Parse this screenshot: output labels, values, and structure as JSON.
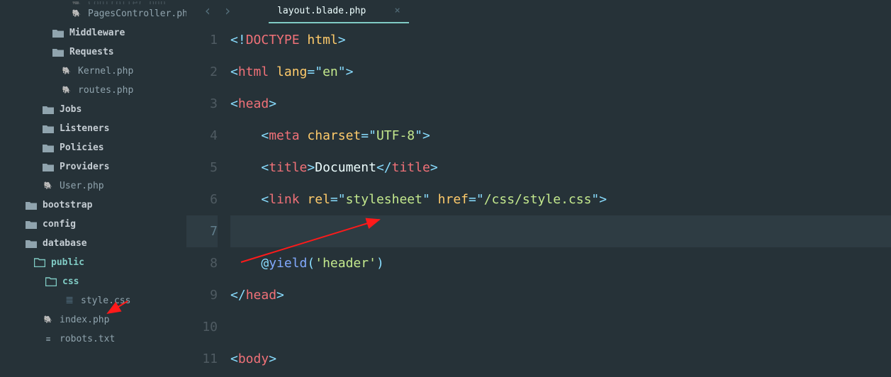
{
  "tab": {
    "title": "layout.blade.php",
    "close": "×"
  },
  "nav": {
    "back": "‹",
    "forward": "›"
  },
  "sidebar": {
    "items": [
      {
        "label": "Controller.php",
        "icon": "php",
        "indent": 100,
        "type": "file"
      },
      {
        "label": "PagesController.php",
        "icon": "php",
        "indent": 100,
        "type": "file"
      },
      {
        "label": "Middleware",
        "icon": "folder",
        "indent": 74,
        "type": "folder",
        "bold": true
      },
      {
        "label": "Requests",
        "icon": "folder",
        "indent": 74,
        "type": "folder",
        "bold": true
      },
      {
        "label": "Kernel.php",
        "icon": "php",
        "indent": 86,
        "type": "file"
      },
      {
        "label": "routes.php",
        "icon": "php",
        "indent": 86,
        "type": "file"
      },
      {
        "label": "Jobs",
        "icon": "folder",
        "indent": 60,
        "type": "folder",
        "bold": true
      },
      {
        "label": "Listeners",
        "icon": "folder",
        "indent": 60,
        "type": "folder",
        "bold": true
      },
      {
        "label": "Policies",
        "icon": "folder",
        "indent": 60,
        "type": "folder",
        "bold": true
      },
      {
        "label": "Providers",
        "icon": "folder",
        "indent": 60,
        "type": "folder",
        "bold": true
      },
      {
        "label": "User.php",
        "icon": "php",
        "indent": 60,
        "type": "file"
      },
      {
        "label": "bootstrap",
        "icon": "folder",
        "indent": 36,
        "type": "folder",
        "bold": true
      },
      {
        "label": "config",
        "icon": "folder",
        "indent": 36,
        "type": "folder",
        "bold": true
      },
      {
        "label": "database",
        "icon": "folder",
        "indent": 36,
        "type": "folder",
        "bold": true
      },
      {
        "label": "public",
        "icon": "folder-open",
        "indent": 48,
        "type": "folder",
        "bold": true,
        "active": true
      },
      {
        "label": "css",
        "icon": "folder-open",
        "indent": 64,
        "type": "folder",
        "bold": true,
        "active": true
      },
      {
        "label": "style.css",
        "icon": "css",
        "indent": 90,
        "type": "file"
      },
      {
        "label": "index.php",
        "icon": "php",
        "indent": 60,
        "type": "file"
      },
      {
        "label": "robots.txt",
        "icon": "txt",
        "indent": 60,
        "type": "file"
      }
    ]
  },
  "code": {
    "lines": [
      {
        "n": 1,
        "segs": [
          [
            "<!",
            "bracket"
          ],
          [
            "DOCTYPE ",
            "tag"
          ],
          [
            "html",
            "attr"
          ],
          [
            ">",
            "bracket"
          ]
        ]
      },
      {
        "n": 2,
        "segs": [
          [
            "<",
            "bracket"
          ],
          [
            "html ",
            "tag"
          ],
          [
            "lang",
            "attr"
          ],
          [
            "=",
            "op"
          ],
          [
            "\"",
            "op"
          ],
          [
            "en",
            "str"
          ],
          [
            "\"",
            "op"
          ],
          [
            ">",
            "bracket"
          ]
        ]
      },
      {
        "n": 3,
        "segs": [
          [
            "<",
            "bracket"
          ],
          [
            "head",
            "tag"
          ],
          [
            ">",
            "bracket"
          ]
        ]
      },
      {
        "n": 4,
        "segs": [
          [
            "    ",
            ""
          ],
          [
            "<",
            "bracket"
          ],
          [
            "meta ",
            "tag"
          ],
          [
            "charset",
            "attr"
          ],
          [
            "=",
            "op"
          ],
          [
            "\"",
            "op"
          ],
          [
            "UTF-8",
            "str"
          ],
          [
            "\"",
            "op"
          ],
          [
            ">",
            "bracket"
          ]
        ]
      },
      {
        "n": 5,
        "segs": [
          [
            "    ",
            ""
          ],
          [
            "<",
            "bracket"
          ],
          [
            "title",
            "tag"
          ],
          [
            ">",
            "bracket"
          ],
          [
            "Document",
            "text"
          ],
          [
            "</",
            "bracket"
          ],
          [
            "title",
            "tag"
          ],
          [
            ">",
            "bracket"
          ]
        ]
      },
      {
        "n": 6,
        "segs": [
          [
            "    ",
            ""
          ],
          [
            "<",
            "bracket"
          ],
          [
            "link ",
            "tag"
          ],
          [
            "rel",
            "attr"
          ],
          [
            "=",
            "op"
          ],
          [
            "\"",
            "op"
          ],
          [
            "stylesheet",
            "str"
          ],
          [
            "\"",
            "op"
          ],
          [
            " ",
            ""
          ],
          [
            "href",
            "attr"
          ],
          [
            "=",
            "op"
          ],
          [
            "\"",
            "op"
          ],
          [
            "/css/style.css",
            "str"
          ],
          [
            "\"",
            "op"
          ],
          [
            ">",
            "bracket"
          ]
        ]
      },
      {
        "n": 7,
        "segs": [],
        "hl": true
      },
      {
        "n": 8,
        "segs": [
          [
            "    ",
            ""
          ],
          [
            "@",
            "dir"
          ],
          [
            "yield",
            "func"
          ],
          [
            "(",
            "bracket"
          ],
          [
            "'header'",
            "str"
          ],
          [
            ")",
            "bracket"
          ]
        ]
      },
      {
        "n": 9,
        "segs": [
          [
            "</",
            "bracket"
          ],
          [
            "head",
            "tag"
          ],
          [
            ">",
            "bracket"
          ]
        ]
      },
      {
        "n": 10,
        "segs": []
      },
      {
        "n": 11,
        "segs": [
          [
            "<",
            "bracket"
          ],
          [
            "body",
            "tag"
          ],
          [
            ">",
            "bracket"
          ]
        ]
      }
    ]
  }
}
